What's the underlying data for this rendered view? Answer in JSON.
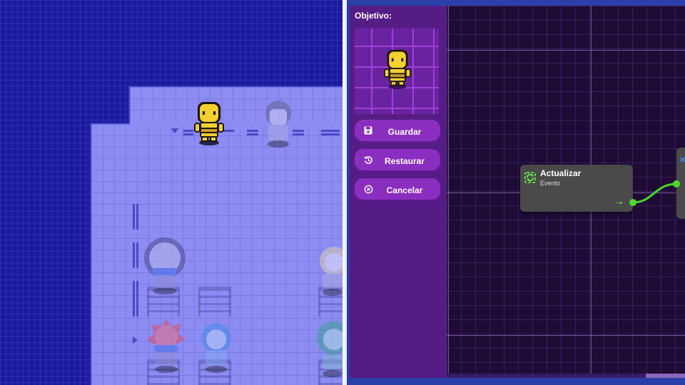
{
  "panel": {
    "objective_label": "Objetivo:"
  },
  "buttons": {
    "save": {
      "label": "Guardar",
      "icon": "floppy-disk-icon"
    },
    "restore": {
      "label": "Restaurar",
      "icon": "history-icon"
    },
    "cancel": {
      "label": "Cancelar",
      "icon": "cancel-circle-icon"
    }
  },
  "node": {
    "title": "Actualizar",
    "subtitle": "Evento",
    "icon": "refresh-icon",
    "port_icon": "arrow-right-icon"
  },
  "colors": {
    "map_void": "#1a1a9c",
    "room_floor": "#8c8cf2",
    "panel_purple": "#561c86",
    "button_purple": "#8a2ec0",
    "canvas_bg": "#1e0c36",
    "node_bg": "#4a4a4a",
    "connector_green": "#4cd82a",
    "character_yellow": "#f4d030"
  }
}
